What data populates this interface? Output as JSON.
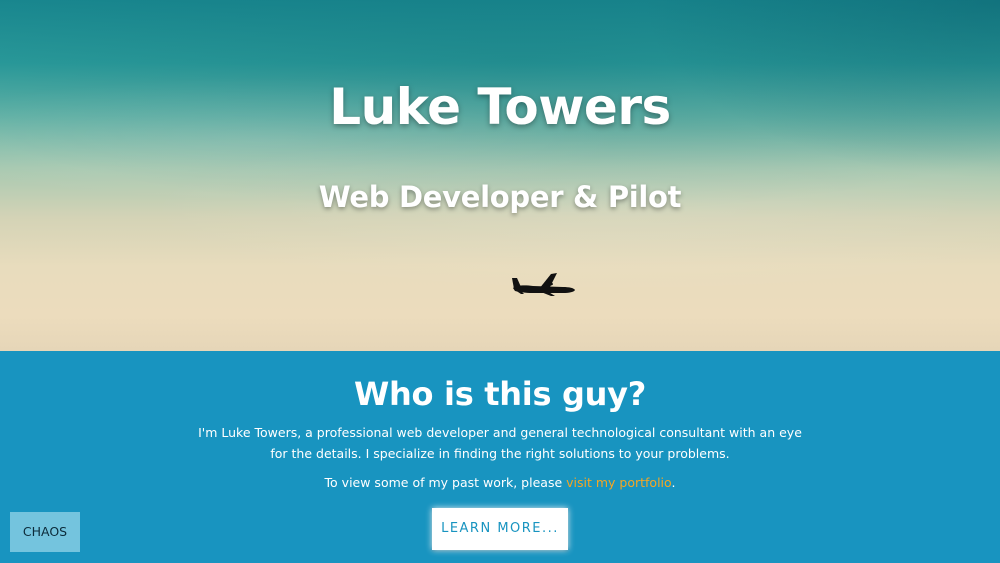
{
  "hero": {
    "title": "Luke Towers",
    "subtitle": "Web Developer & Pilot"
  },
  "about": {
    "heading": "Who is this guy?",
    "intro": "I'm Luke Towers, a professional web developer and general technological consultant with an eye for the details. I specialize in finding the right solutions to your problems.",
    "portfolio_prefix": "To view some of my past work, please ",
    "portfolio_link": "visit my portfolio",
    "portfolio_suffix": ".",
    "learn_more_label": "LEARN MORE..."
  },
  "chaos_button": {
    "label": "CHAOS"
  },
  "icons": {
    "plane": "airplane-icon"
  },
  "colors": {
    "section_bg": "#1894c0",
    "link": "#f5a623",
    "chaos_bg": "#74c4de"
  }
}
